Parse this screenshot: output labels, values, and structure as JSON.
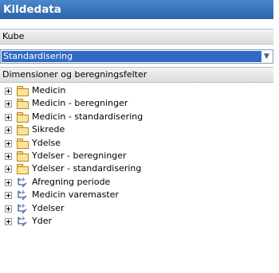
{
  "panel": {
    "title": "Kildedata",
    "cube_section_label": "Kube",
    "cube_selected": "Standardisering",
    "dimensions_section_label": "Dimensioner og beregningsfelter"
  },
  "tree": [
    {
      "label": "Medicin",
      "icon": "folder-icon"
    },
    {
      "label": "Medicin - beregninger",
      "icon": "folder-icon"
    },
    {
      "label": "Medicin - standardisering",
      "icon": "folder-icon"
    },
    {
      "label": "Sikrede",
      "icon": "folder-icon"
    },
    {
      "label": "Ydelse",
      "icon": "folder-icon"
    },
    {
      "label": "Ydelser - beregninger",
      "icon": "folder-icon"
    },
    {
      "label": "Ydelser - standardisering",
      "icon": "folder-icon"
    },
    {
      "label": "Afregning periode",
      "icon": "dimension-icon"
    },
    {
      "label": "Medicin varemaster",
      "icon": "dimension-icon"
    },
    {
      "label": "Ydelser",
      "icon": "dimension-icon"
    },
    {
      "label": "Yder",
      "icon": "dimension-icon"
    }
  ],
  "colors": {
    "title_bar": "#2a63a8",
    "selection": "#316ac5",
    "folder": "#fbe39b"
  }
}
